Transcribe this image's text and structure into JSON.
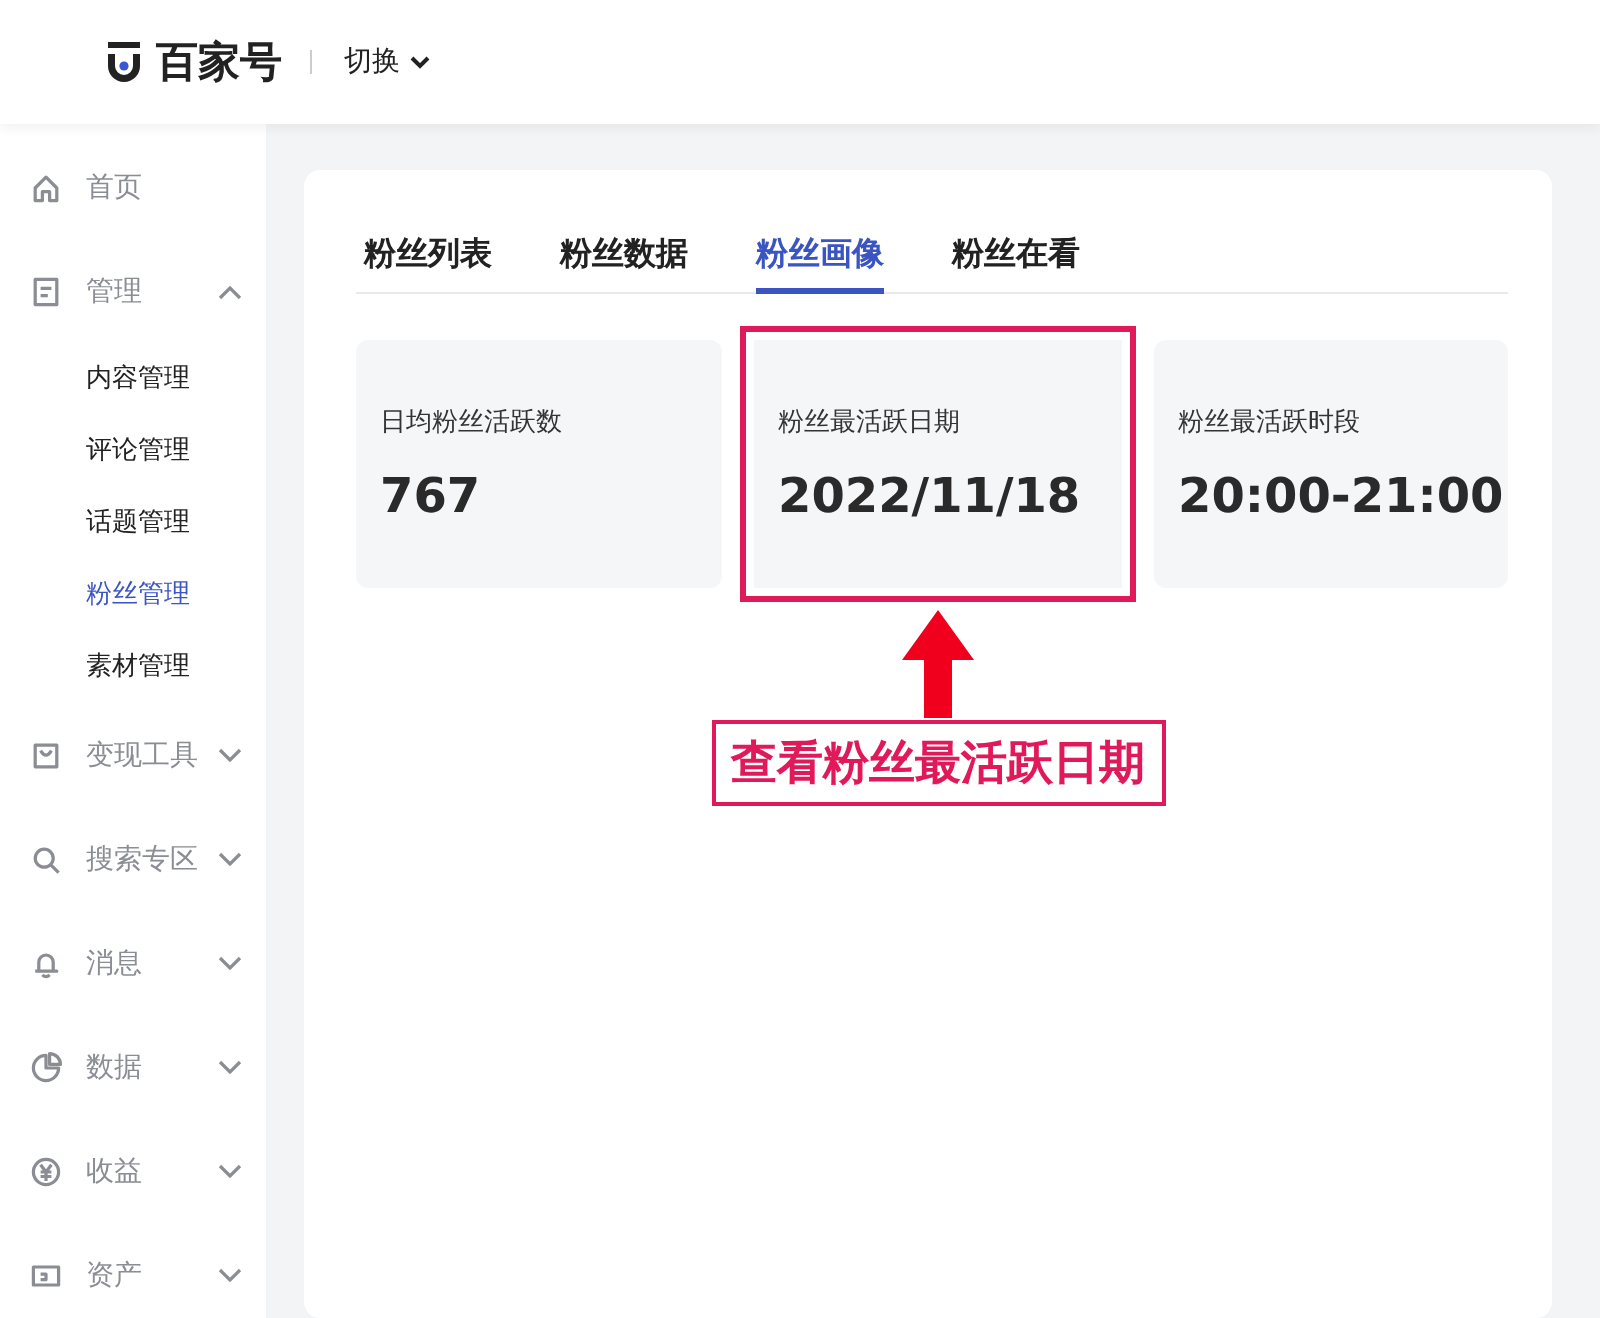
{
  "header": {
    "brand": "百家号",
    "switch_label": "切换"
  },
  "sidebar": {
    "items": [
      {
        "label": "首页",
        "kind": "link"
      },
      {
        "label": "管理",
        "kind": "group",
        "expanded": true,
        "children": [
          {
            "label": "内容管理",
            "selected": false
          },
          {
            "label": "评论管理",
            "selected": false
          },
          {
            "label": "话题管理",
            "selected": false
          },
          {
            "label": "粉丝管理",
            "selected": true
          },
          {
            "label": "素材管理",
            "selected": false
          }
        ]
      },
      {
        "label": "变现工具",
        "kind": "group",
        "expanded": false
      },
      {
        "label": "搜索专区",
        "kind": "group",
        "expanded": false
      },
      {
        "label": "消息",
        "kind": "group",
        "expanded": false
      },
      {
        "label": "数据",
        "kind": "group",
        "expanded": false
      },
      {
        "label": "收益",
        "kind": "group",
        "expanded": false
      },
      {
        "label": "资产",
        "kind": "group",
        "expanded": false
      }
    ]
  },
  "tabs": [
    {
      "label": "粉丝列表",
      "selected": false
    },
    {
      "label": "粉丝数据",
      "selected": false
    },
    {
      "label": "粉丝画像",
      "selected": true
    },
    {
      "label": "粉丝在看",
      "selected": false
    }
  ],
  "stats": [
    {
      "label": "日均粉丝活跃数",
      "value": "767",
      "highlighted": false
    },
    {
      "label": "粉丝最活跃日期",
      "value": "2022/11/18",
      "highlighted": true
    },
    {
      "label": "粉丝最活跃时段",
      "value": "20:00-21:00",
      "highlighted": false
    }
  ],
  "annotation": {
    "text": "查看粉丝最活跃日期"
  }
}
